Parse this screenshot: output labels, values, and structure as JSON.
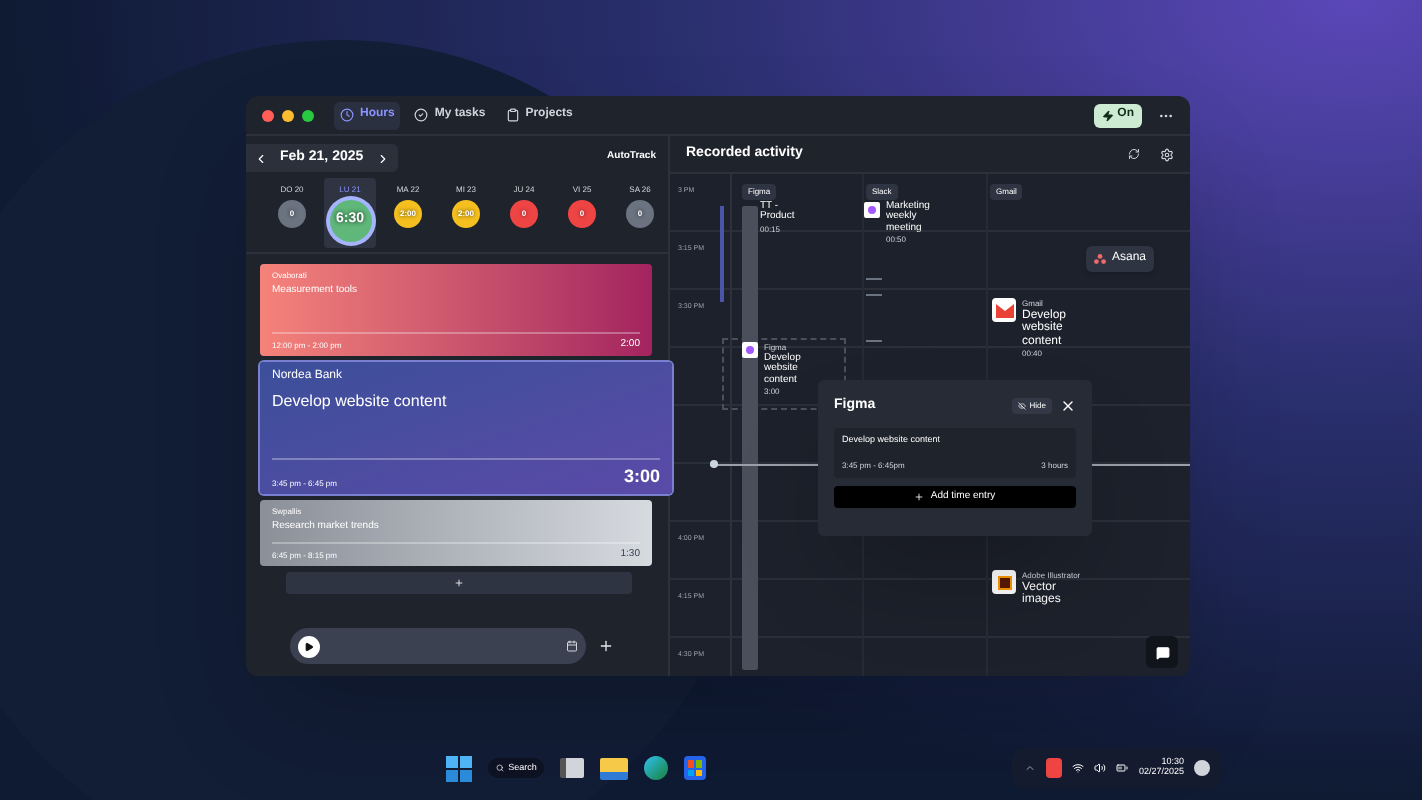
{
  "window": {
    "tabs": [
      {
        "label": "Hours",
        "selected": true
      },
      {
        "label": "My tasks",
        "selected": false
      },
      {
        "label": "Projects",
        "selected": false
      }
    ],
    "status_button": "On"
  },
  "left": {
    "date": "Feb 21, 2025",
    "autotrack": "AutoTrack",
    "days": [
      {
        "label": "DO 20",
        "value": "0",
        "selected": false,
        "color": "#6b7280"
      },
      {
        "label": "LU 21",
        "value": "6:30",
        "selected": true,
        "color": "#5fb77a"
      },
      {
        "label": "MA 22",
        "value": "2:00",
        "selected": false,
        "color": "#f5c01f"
      },
      {
        "label": "MI 23",
        "value": "2:00",
        "selected": false,
        "color": "#f5c01f"
      },
      {
        "label": "JU 24",
        "value": "0",
        "selected": false,
        "color": "#ef4444"
      },
      {
        "label": "VI 25",
        "value": "0",
        "selected": false,
        "color": "#ef4444"
      },
      {
        "label": "SA 26",
        "value": "0",
        "selected": false,
        "color": "#6b7280"
      }
    ],
    "entries": [
      {
        "kind": "coral",
        "client": "Ovaborati",
        "title": "Measurement tools",
        "time": "12:00 pm - 2:00 pm",
        "duration": "2:00"
      },
      {
        "kind": "active",
        "client": "Nordea Bank",
        "title": "Develop website content",
        "time": "3:45 pm - 6:45 pm",
        "duration": "3:00"
      },
      {
        "kind": "silver",
        "client": "Swpallis",
        "title": "Research market trends",
        "time": "6:45 pm - 8:15 pm",
        "duration": "1:30"
      }
    ]
  },
  "right": {
    "title": "Recorded activity",
    "time_labels": [
      "3 PM",
      "3:15 PM",
      "3:30 PM",
      "4:00 PM",
      "4:15 PM",
      "4:30 PM"
    ],
    "app_columns": [
      "Figma",
      "Slack",
      "Gmail"
    ],
    "activities": [
      {
        "kind": "bar",
        "title": "TT - Product",
        "duration": "00:15"
      },
      {
        "kind": "slack",
        "title": "Marketing weekly meeting",
        "duration": "00:50"
      },
      {
        "kind": "gmail",
        "app": "Gmail",
        "title": "Develop website content",
        "duration": "00:40"
      },
      {
        "kind": "figma",
        "app": "Figma",
        "title": "Develop website content",
        "duration": "3:00"
      },
      {
        "kind": "illustrator",
        "app": "Adobe Illustrator",
        "title": "Vector images"
      }
    ],
    "tooltip": "Asana",
    "popover": {
      "title": "Figma",
      "hide": "Hide",
      "task": "Develop website content",
      "time": "3:45 pm - 6:45pm",
      "duration": "3 hours",
      "button": "Add time entry"
    }
  },
  "taskbar": {
    "search": "Search",
    "time": "10:30",
    "date": "02/27/2025"
  }
}
